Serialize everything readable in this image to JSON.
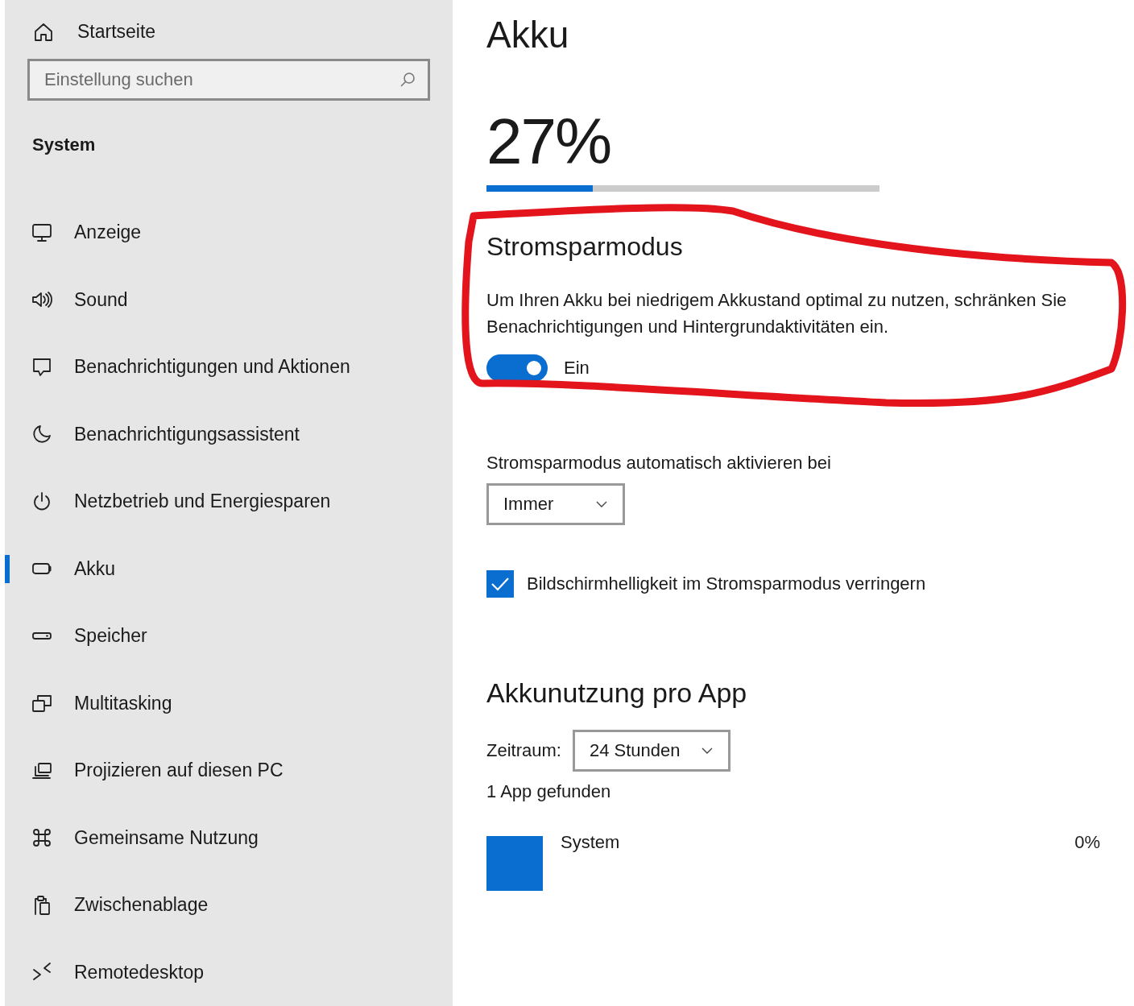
{
  "sidebar": {
    "home": {
      "label": "Startseite"
    },
    "search": {
      "placeholder": "Einstellung suchen"
    },
    "section": "System",
    "items": [
      {
        "label": "Anzeige",
        "selected": false
      },
      {
        "label": "Sound",
        "selected": false
      },
      {
        "label": "Benachrichtigungen und Aktionen",
        "selected": false
      },
      {
        "label": "Benachrichtigungsassistent",
        "selected": false
      },
      {
        "label": "Netzbetrieb und Energiesparen",
        "selected": false
      },
      {
        "label": "Akku",
        "selected": true
      },
      {
        "label": "Speicher",
        "selected": false
      },
      {
        "label": "Multitasking",
        "selected": false
      },
      {
        "label": "Projizieren auf diesen PC",
        "selected": false
      },
      {
        "label": "Gemeinsame Nutzung",
        "selected": false
      },
      {
        "label": "Zwischenablage",
        "selected": false
      },
      {
        "label": "Remotedesktop",
        "selected": false
      }
    ]
  },
  "main": {
    "title": "Akku",
    "battery": {
      "percent": "27%",
      "level": 0.27
    },
    "saver": {
      "heading": "Stromsparmodus",
      "description": "Um Ihren Akku bei niedrigem Akkustand optimal zu nutzen, schränken Sie Benachrichtigungen und Hintergrundaktivitäten ein.",
      "toggle": {
        "on": true,
        "label": "Ein"
      }
    },
    "auto": {
      "label": "Stromsparmodus automatisch aktivieren bei",
      "value": "Immer"
    },
    "dim": {
      "label": "Bildschirmhelligkeit im Stromsparmodus verringern",
      "checked": true
    },
    "usage": {
      "heading": "Akkunutzung pro App",
      "period_label": "Zeitraum:",
      "period_value": "24 Stunden",
      "count": "1 App gefunden",
      "apps": [
        {
          "name": "System",
          "share": "0%"
        }
      ]
    }
  }
}
